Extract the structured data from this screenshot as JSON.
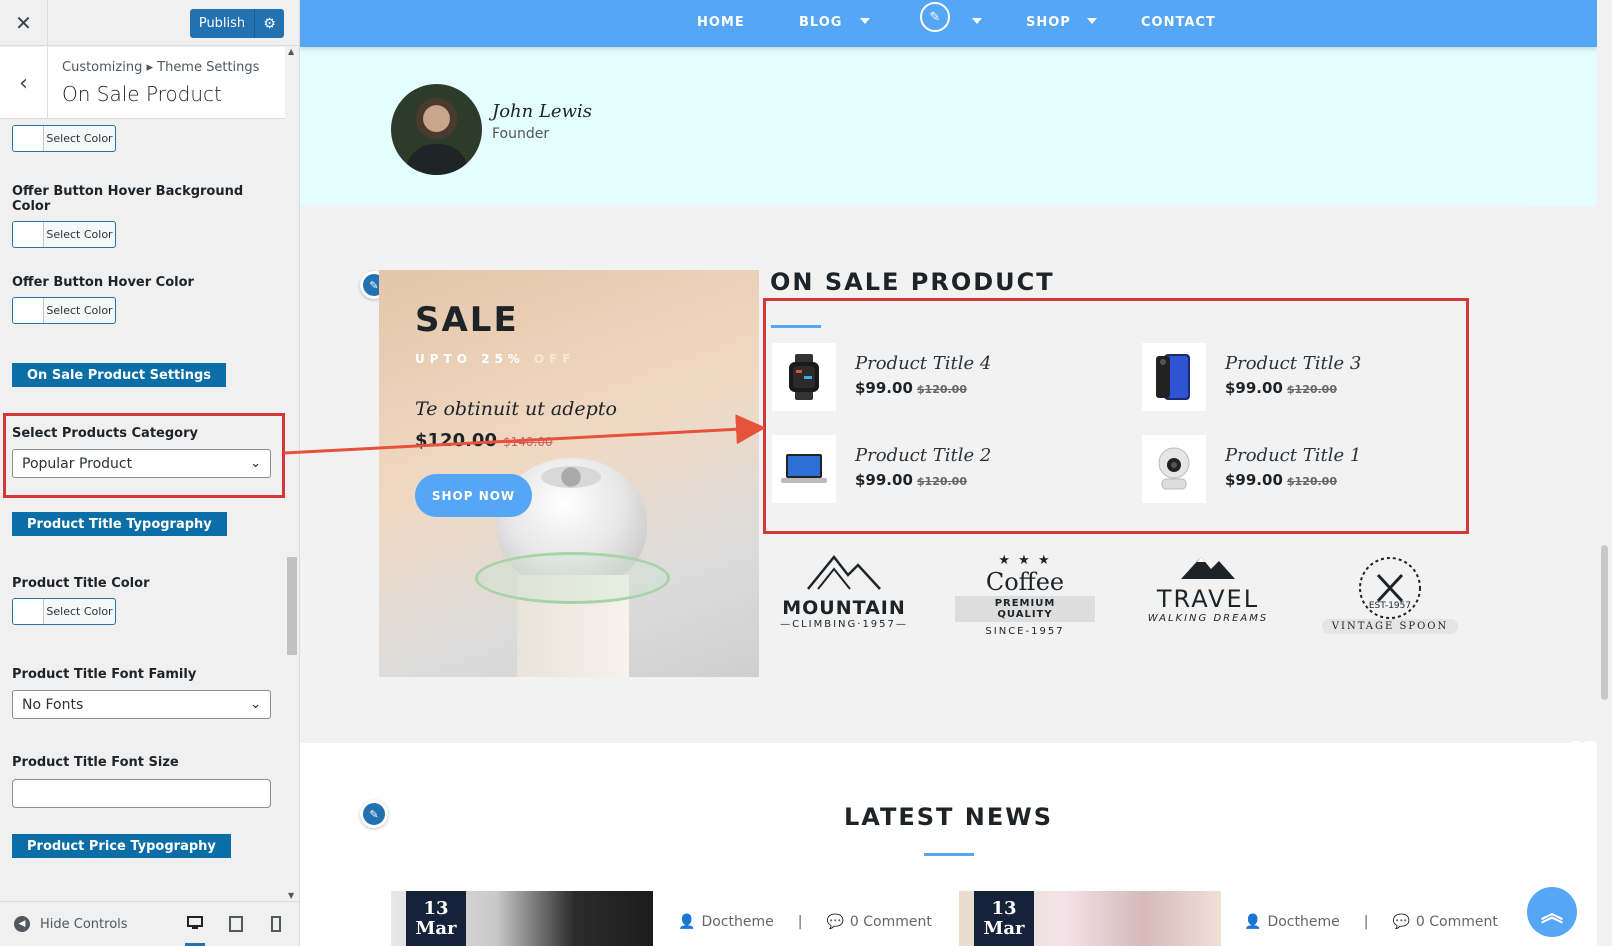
{
  "sidebar": {
    "close_icon": "close-icon",
    "publish_label": "Publish",
    "breadcrumb": "Customizing ▸ Theme Settings",
    "title": "On Sale Product",
    "controls": {
      "color_select_label": "Select Color",
      "offer_hover_bg_label": "Offer Button Hover Background Color",
      "offer_hover_color_label": "Offer Button Hover Color",
      "on_sale_settings_button": "On Sale Product Settings",
      "select_category_label": "Select Products Category",
      "select_category_value": "Popular Product",
      "title_typography_button": "Product Title Typography",
      "title_color_label": "Product Title Color",
      "title_font_family_label": "Product Title Font Family",
      "title_font_family_value": "No Fonts",
      "title_font_size_label": "Product Title Font Size",
      "title_font_size_value": "",
      "price_typography_button": "Product Price Typography"
    },
    "footer": {
      "hide_controls": "Hide Controls"
    }
  },
  "nav": {
    "items": [
      "HOME",
      "BLOG",
      "SHOP",
      "CONTACT"
    ]
  },
  "testimonial": {
    "name": "John Lewis",
    "role": "Founder"
  },
  "banner": {
    "sale": "SALE",
    "upto": "UPTO 25%",
    "off": "OFF",
    "tagline": "Te obtinuit ut adepto",
    "price": "$120.00",
    "old_price": "$140.00",
    "shop_now": "SHOP NOW"
  },
  "on_sale": {
    "heading": "ON SALE PRODUCT",
    "products": [
      {
        "title": "Product Title 4",
        "price": "$99.00",
        "old_price": "$120.00"
      },
      {
        "title": "Product Title 3",
        "price": "$99.00",
        "old_price": "$120.00"
      },
      {
        "title": "Product Title 2",
        "price": "$99.00",
        "old_price": "$120.00"
      },
      {
        "title": "Product Title 1",
        "price": "$99.00",
        "old_price": "$120.00"
      }
    ]
  },
  "brands": [
    {
      "main": "MOUNTAIN",
      "sub": "—CLIMBING·1957—"
    },
    {
      "main": "Coffee",
      "badge": "PREMIUM QUALITY",
      "sub": "SINCE-1957"
    },
    {
      "main": "TRAVEL",
      "sub": "WALKING DREAMS"
    },
    {
      "main": "EST-1957",
      "sub": "VINTAGE SPOON"
    }
  ],
  "news": {
    "heading": "LATEST NEWS",
    "cards": [
      {
        "day": "13",
        "month": "Mar",
        "author": "Doctheme",
        "comments": "0 Comment"
      },
      {
        "day": "13",
        "month": "Mar",
        "author": "Doctheme",
        "comments": "0 Comment"
      }
    ]
  },
  "colors": {
    "accent": "#55a6f5",
    "wp_blue": "#2271b1",
    "highlight_red": "#d63638"
  }
}
